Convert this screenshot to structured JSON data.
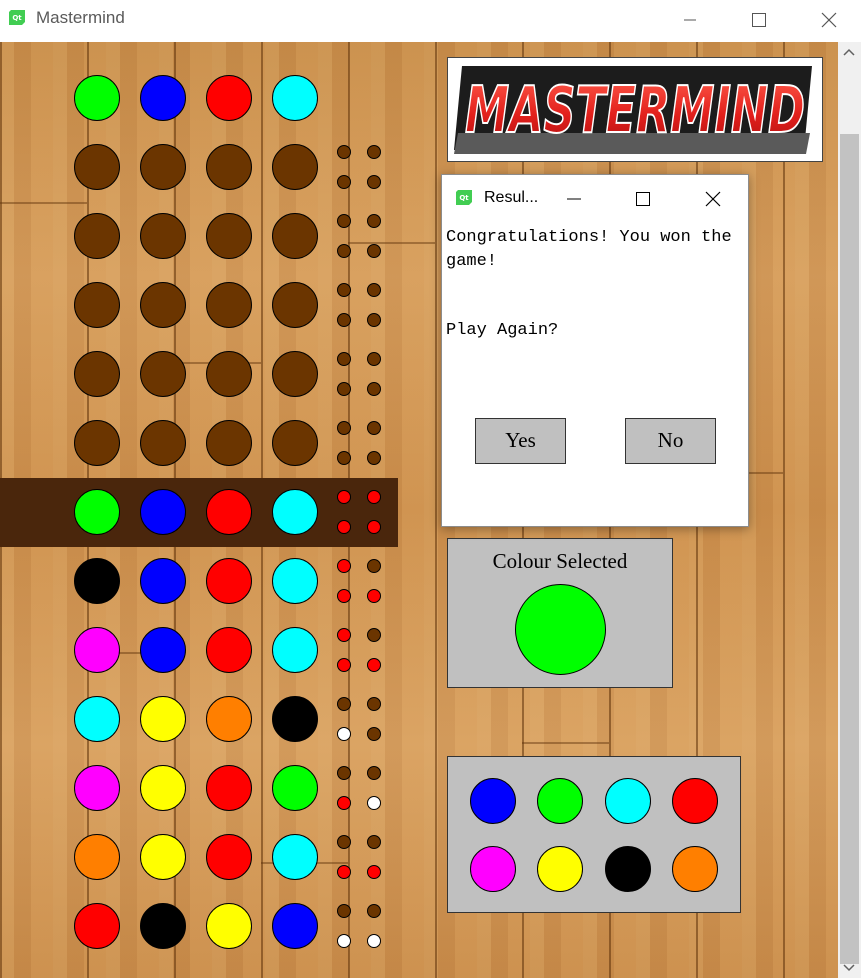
{
  "window": {
    "title": "Mastermind"
  },
  "colors": {
    "green": "#00ff00",
    "blue": "#0000ff",
    "red": "#ff0000",
    "cyan": "#00ffff",
    "magenta": "#ff00ff",
    "yellow": "#ffff00",
    "black": "#000000",
    "orange": "#ff7f00",
    "empty_peg": "#6b3500",
    "key_empty": "#6b3500",
    "key_red": "#ff0000",
    "key_white": "#ffffff"
  },
  "board": {
    "secret_code": [
      "green",
      "blue",
      "red",
      "cyan"
    ],
    "guesses": [
      {
        "pegs": [
          "empty_peg",
          "empty_peg",
          "empty_peg",
          "empty_peg"
        ],
        "keys": [
          "key_empty",
          "key_empty",
          "key_empty",
          "key_empty"
        ]
      },
      {
        "pegs": [
          "empty_peg",
          "empty_peg",
          "empty_peg",
          "empty_peg"
        ],
        "keys": [
          "key_empty",
          "key_empty",
          "key_empty",
          "key_empty"
        ]
      },
      {
        "pegs": [
          "empty_peg",
          "empty_peg",
          "empty_peg",
          "empty_peg"
        ],
        "keys": [
          "key_empty",
          "key_empty",
          "key_empty",
          "key_empty"
        ]
      },
      {
        "pegs": [
          "empty_peg",
          "empty_peg",
          "empty_peg",
          "empty_peg"
        ],
        "keys": [
          "key_empty",
          "key_empty",
          "key_empty",
          "key_empty"
        ]
      },
      {
        "pegs": [
          "empty_peg",
          "empty_peg",
          "empty_peg",
          "empty_peg"
        ],
        "keys": [
          "key_empty",
          "key_empty",
          "key_empty",
          "key_empty"
        ]
      },
      {
        "pegs": [
          "green",
          "blue",
          "red",
          "cyan"
        ],
        "keys": [
          "key_red",
          "key_red",
          "key_red",
          "key_red"
        ],
        "current": true
      },
      {
        "pegs": [
          "black",
          "blue",
          "red",
          "cyan"
        ],
        "keys": [
          "key_red",
          "key_empty",
          "key_red",
          "key_red"
        ]
      },
      {
        "pegs": [
          "magenta",
          "blue",
          "red",
          "cyan"
        ],
        "keys": [
          "key_red",
          "key_empty",
          "key_red",
          "key_red"
        ]
      },
      {
        "pegs": [
          "cyan",
          "yellow",
          "orange",
          "black"
        ],
        "keys": [
          "key_empty",
          "key_empty",
          "key_white",
          "key_empty"
        ]
      },
      {
        "pegs": [
          "magenta",
          "yellow",
          "red",
          "green"
        ],
        "keys": [
          "key_empty",
          "key_empty",
          "key_red",
          "key_white"
        ]
      },
      {
        "pegs": [
          "orange",
          "yellow",
          "red",
          "cyan"
        ],
        "keys": [
          "key_empty",
          "key_empty",
          "key_red",
          "key_red"
        ]
      },
      {
        "pegs": [
          "red",
          "black",
          "yellow",
          "blue"
        ],
        "keys": [
          "key_empty",
          "key_empty",
          "key_white",
          "key_white"
        ]
      }
    ]
  },
  "logo": {
    "text": "MASTERMIND"
  },
  "colour_selected": {
    "label": "Colour Selected",
    "color": "green"
  },
  "palette": {
    "colors": [
      "blue",
      "green",
      "cyan",
      "red",
      "magenta",
      "yellow",
      "black",
      "orange"
    ]
  },
  "dialog": {
    "title": "Resul...",
    "message": "Congratulations! You won the game!",
    "prompt": "Play Again?",
    "yes_label": "Yes",
    "no_label": "No"
  }
}
